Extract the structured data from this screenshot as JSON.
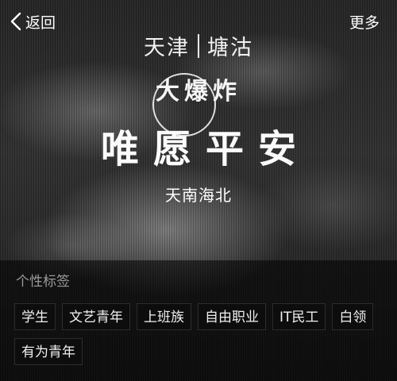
{
  "topbar": {
    "back_label": "返回",
    "more_label": "更多"
  },
  "profile": {
    "city": "天津",
    "district": "塘沽",
    "headline": "大爆炸",
    "motto": "唯愿平安",
    "region": "天南海北"
  },
  "tags_section": {
    "title": "个性标签",
    "tags": [
      "学生",
      "文艺青年",
      "上班族",
      "自由职业",
      "IT民工",
      "白领",
      "有为青年"
    ]
  },
  "icons": {
    "back": "chevron-left-icon"
  }
}
